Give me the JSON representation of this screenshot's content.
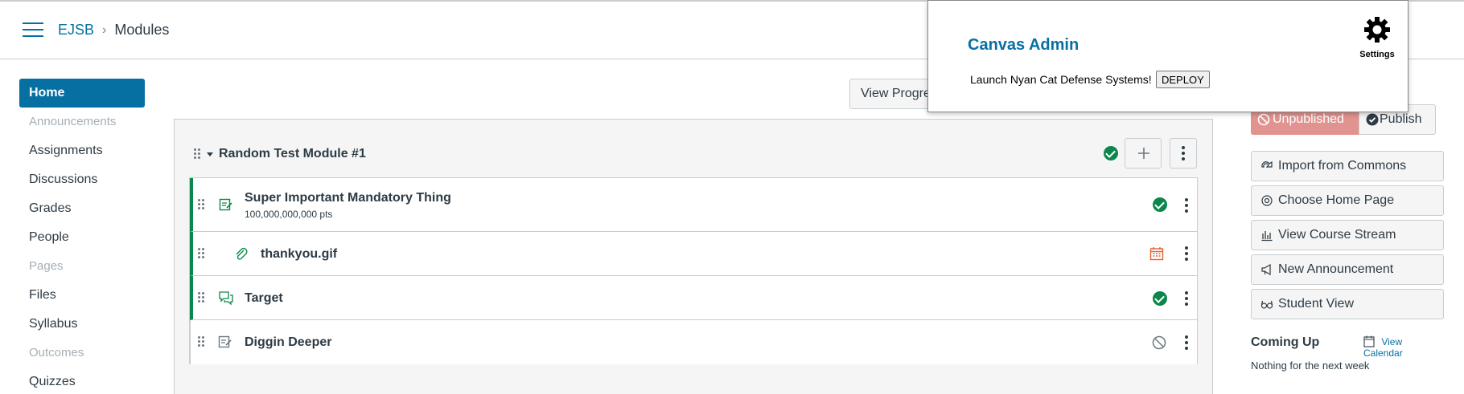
{
  "breadcrumb": {
    "course": "EJSB",
    "current": "Modules"
  },
  "nav": [
    {
      "label": "Home"
    },
    {
      "label": "Announcements"
    },
    {
      "label": "Assignments"
    },
    {
      "label": "Discussions"
    },
    {
      "label": "Grades"
    },
    {
      "label": "People"
    },
    {
      "label": "Pages"
    },
    {
      "label": "Files"
    },
    {
      "label": "Syllabus"
    },
    {
      "label": "Outcomes"
    },
    {
      "label": "Quizzes"
    }
  ],
  "toolbar": {
    "view_progress": "View Progress"
  },
  "module": {
    "title": "Random Test Module #1",
    "items": [
      {
        "title": "Super Important Mandatory Thing",
        "sub": "100,000,000,000 pts",
        "icon": "assignment-icon",
        "status": "published"
      },
      {
        "title": "thankyou.gif",
        "icon": "attachment-icon",
        "status": "due-date"
      },
      {
        "title": "Target",
        "icon": "discussion-icon",
        "status": "published"
      },
      {
        "title": "Diggin Deeper",
        "icon": "assignment-icon",
        "status": "unpublished"
      }
    ]
  },
  "sidebar": {
    "unpublished": "Unpublished",
    "publish": "Publish",
    "buttons": [
      {
        "label": "Import from Commons"
      },
      {
        "label": "Choose Home Page"
      },
      {
        "label": "View Course Stream"
      },
      {
        "label": "New Announcement"
      },
      {
        "label": "Student View"
      }
    ],
    "coming_up": "Coming Up",
    "view_calendar": "View Calendar",
    "nothing": "Nothing for the next week"
  },
  "popup": {
    "title": "Canvas Admin",
    "text": "Launch Nyan Cat Defense Systems!",
    "deploy": "DEPLOY",
    "settings": "Settings"
  },
  "colors": {
    "brand": "#0770a3",
    "success": "#0b874b",
    "danger_light": "#e0938f",
    "warning": "#e66135"
  }
}
